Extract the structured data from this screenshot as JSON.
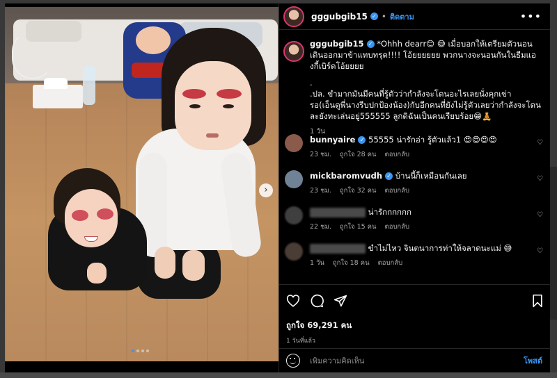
{
  "header": {
    "username": "gggubgib15",
    "follow_label": "ติดตาม",
    "more_icon": "more-options-icon"
  },
  "caption": {
    "username": "gggubgib15",
    "text": "*Ohhh dearr😊 😅 เมื่อบอกให้เตรียมตัวนอนเดินออกมาข้าแทบทรุด!!!! โอ้ยยยยยย พวกนางจะนอนกันในธีมแองกี้เบิร์ดโอ้ยยยย",
    "text2": ".",
    "text3": ".ปล. ขำมากมันมีคนที่รู้ตัวว่ากำลังจะโดนอะไรเลยนั่งคุกเข่ารอ(เอ็นดูพี่นางรีบปกป้องน้อง)กับอีกคนที่ยังไม่รู้ตัวเลยว่ากำลังจะโดนละยังทะเล่นอยู่555555 ลูกดิฉันเป็นคนเรียบร้อย😁🧘",
    "time": "1 วัน"
  },
  "comments": [
    {
      "username": "bunnyaire",
      "verified": true,
      "text": "55555 น่ารักอ่า รู้ตัวแล้ว1 😍😍😍😍",
      "time": "23 ชม.",
      "likes": "ถูกใจ 28 คน",
      "reply": "ตอบกลับ",
      "avatar_color": "#8a5a4a"
    },
    {
      "username": "mickbaromvudh",
      "verified": true,
      "text": "บ้านนี้ก็เหมือนกันเลย",
      "time": "23 ชม.",
      "likes": "ถูกใจ 32 คน",
      "reply": "ตอบกลับ",
      "avatar_color": "#6f8296"
    },
    {
      "username": "",
      "verified": false,
      "text": "น่ารักกกกกก",
      "time": "22 ชม.",
      "likes": "ถูกใจ 15 คน",
      "reply": "ตอบกลับ",
      "avatar_color": "#3f3f3f"
    },
    {
      "username": "",
      "verified": false,
      "text": "ขำไม่ไหว จินตนาการท่าให้จลาดนะแม่ 😅",
      "time": "1 วัน",
      "likes": "ถูกใจ 18 คน",
      "reply": "ตอบกลับ",
      "avatar_color": "#4a3d36"
    }
  ],
  "actions": {
    "likes": "ถูกใจ 69,291 คน",
    "date": "1 วันที่แล้ว"
  },
  "add_comment": {
    "placeholder": "เพิ่มความคิดเห็น",
    "post_label": "โพสต์"
  },
  "carousel": {
    "next_glyph": "›",
    "dots": 4,
    "active_dot": 1
  },
  "colors": {
    "accent": "#3b95f0",
    "background": "#000000"
  }
}
